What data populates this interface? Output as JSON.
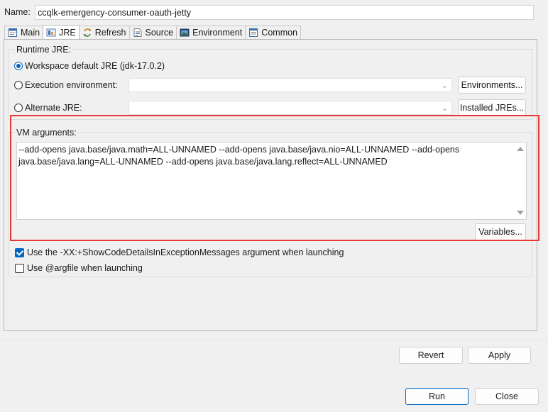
{
  "name": {
    "label": "Name:",
    "value": "ccqlk-emergency-consumer-oauth-jetty"
  },
  "tabs": [
    {
      "label": "Main",
      "icon": "main-tab-icon",
      "active": false
    },
    {
      "label": "JRE",
      "icon": "jre-tab-icon",
      "active": true
    },
    {
      "label": "Refresh",
      "icon": "refresh-tab-icon",
      "active": false
    },
    {
      "label": "Source",
      "icon": "source-tab-icon",
      "active": false
    },
    {
      "label": "Environment",
      "icon": "environment-tab-icon",
      "active": false
    },
    {
      "label": "Common",
      "icon": "common-tab-icon",
      "active": false
    }
  ],
  "runtime_jre": {
    "title": "Runtime JRE:",
    "workspace_default": "Workspace default JRE (jdk-17.0.2)",
    "execution_environment": "Execution environment:",
    "alternate_jre": "Alternate JRE:",
    "environments_button": "Environments...",
    "installed_jres_button": "Installed JREs...",
    "selected": "workspace_default"
  },
  "vm_arguments": {
    "title": "VM arguments:",
    "value": "--add-opens java.base/java.math=ALL-UNNAMED --add-opens java.base/java.nio=ALL-UNNAMED --add-opens java.base/java.lang=ALL-UNNAMED --add-opens java.base/java.lang.reflect=ALL-UNNAMED",
    "variables_button": "Variables..."
  },
  "options": {
    "show_code_details": {
      "label": "Use the -XX:+ShowCodeDetailsInExceptionMessages argument when launching",
      "checked": true
    },
    "argfile": {
      "label": "Use @argfile when launching",
      "checked": false
    }
  },
  "footer": {
    "revert": "Revert",
    "apply": "Apply",
    "run": "Run",
    "close": "Close"
  },
  "colors": {
    "accent": "#0067c0",
    "highlight": "#e53935"
  }
}
